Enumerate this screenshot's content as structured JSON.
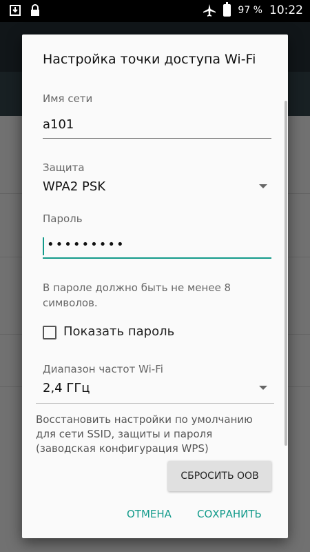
{
  "status_bar": {
    "battery": "97 %",
    "time": "10:22"
  },
  "dialog": {
    "title": "Настройка точки доступа Wi-Fi",
    "ssid": {
      "label": "Имя сети",
      "value": "a101"
    },
    "security": {
      "label": "Защита",
      "value": "WPA2 PSK"
    },
    "password": {
      "label": "Пароль",
      "value": "•••••••••"
    },
    "password_hint": "В пароле должно быть не менее 8 символов.",
    "show_password": {
      "label": "Показать пароль",
      "checked": false
    },
    "band": {
      "label": "Диапазон частот Wi-Fi",
      "value": "2,4 ГГц"
    },
    "reset_text": "Восстановить настройки по умолчанию для сети SSID, защиты и пароля (заводская конфигурация WPS)",
    "reset_button": "СБРОСИТЬ ООВ",
    "cancel": "ОТМЕНА",
    "save": "СОХРАНИТЬ"
  },
  "colors": {
    "accent": "#129a8a"
  }
}
